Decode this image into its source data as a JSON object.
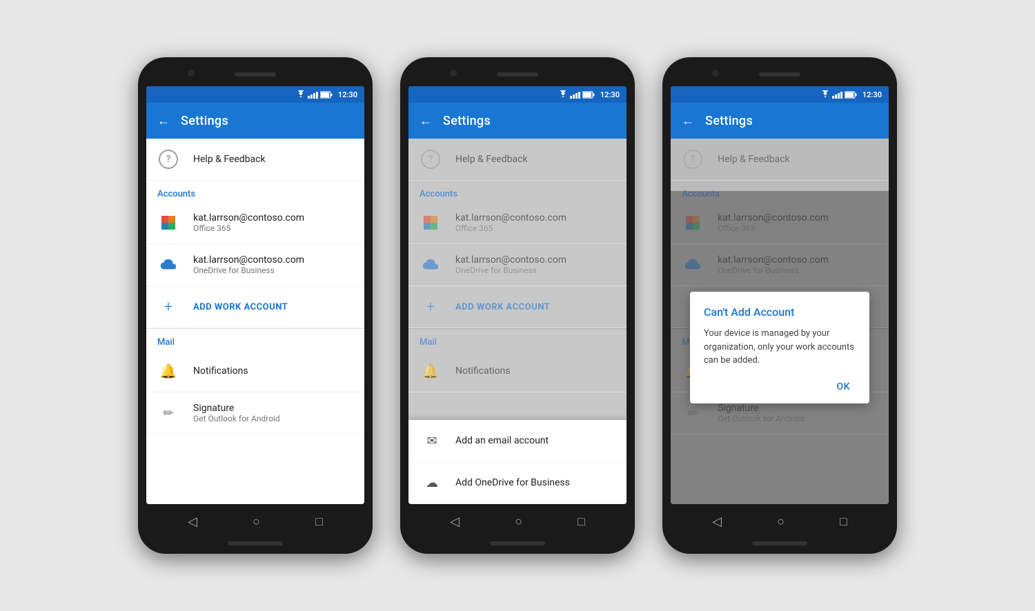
{
  "phones": [
    {
      "id": "phone1",
      "statusBar": {
        "time": "12:30"
      },
      "appBar": {
        "title": "Settings",
        "backLabel": "←"
      },
      "menuItems": [
        {
          "icon": "help",
          "title": "Help & Feedback",
          "subtitle": ""
        }
      ],
      "sections": [
        {
          "label": "Accounts",
          "items": [
            {
              "icon": "office365",
              "title": "kat.larrson@contoso.com",
              "subtitle": "Office 365"
            },
            {
              "icon": "onedrive",
              "title": "kat.larrson@contoso.com",
              "subtitle": "OneDrive for Business"
            }
          ],
          "addButton": "ADD WORK ACCOUNT"
        },
        {
          "label": "Mail",
          "items": [
            {
              "icon": "bell",
              "title": "Notifications",
              "subtitle": ""
            },
            {
              "icon": "pencil",
              "title": "Signature",
              "subtitle": "Get Outlook for Android"
            }
          ]
        }
      ]
    },
    {
      "id": "phone2",
      "statusBar": {
        "time": "12:30"
      },
      "appBar": {
        "title": "Settings",
        "backLabel": "←"
      },
      "hasDropdown": true,
      "dropdownItems": [
        {
          "icon": "email",
          "label": "Add an email account"
        },
        {
          "icon": "cloud",
          "label": "Add OneDrive for Business"
        }
      ]
    },
    {
      "id": "phone3",
      "statusBar": {
        "time": "12:30"
      },
      "appBar": {
        "title": "Settings",
        "backLabel": "←"
      },
      "hasDialog": true,
      "dialog": {
        "title": "Can't Add Account",
        "body": "Your device is managed by your organization, only your work accounts can be added.",
        "okLabel": "OK"
      }
    }
  ],
  "sharedContent": {
    "helpFeedback": "Help & Feedback",
    "accountsLabel": "Accounts",
    "mailLabel": "Mail",
    "account1Email": "kat.larrson@contoso.com",
    "account1Type": "Office 365",
    "account2Email": "kat.larrson@contoso.com",
    "account2Type": "OneDrive for Business",
    "addWorkAccount": "ADD WORK ACCOUNT",
    "notifications": "Notifications",
    "signature": "Signature",
    "signatureSubtitle": "Get Outlook for Android"
  }
}
